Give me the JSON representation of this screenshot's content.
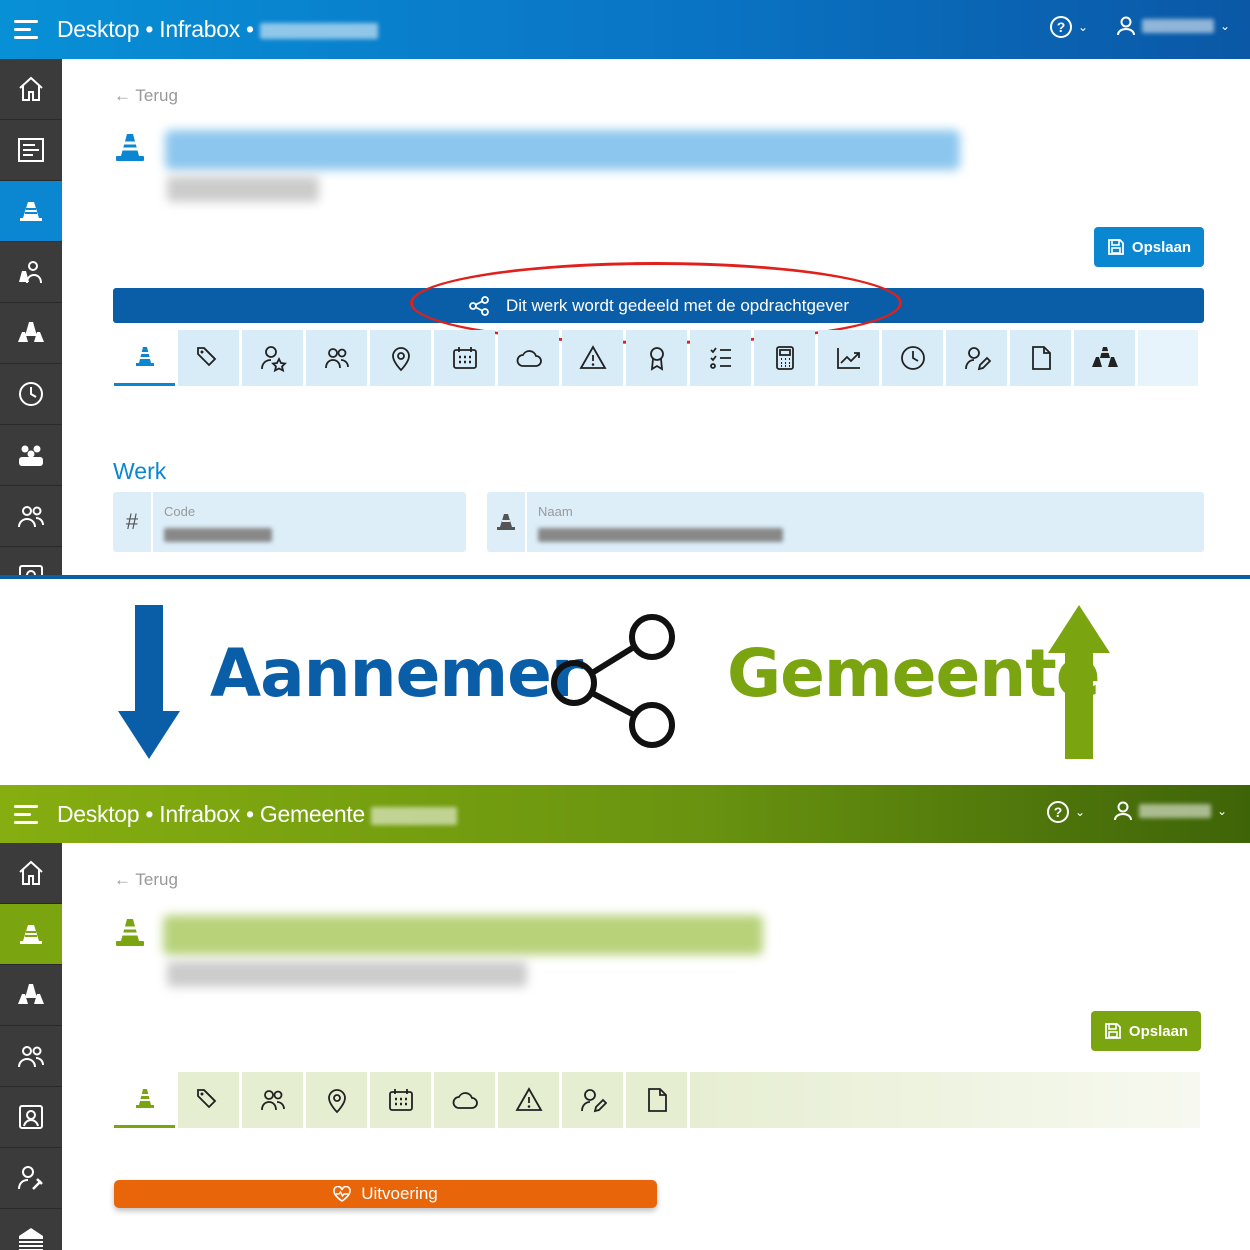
{
  "top": {
    "header": {
      "app": "Desktop",
      "sep": "•",
      "module": "Infrabox",
      "help_icon": "help-circle-icon",
      "user_icon": "user-icon"
    },
    "back_label": "Terug",
    "save_label": "Opslaan",
    "share_banner": "Dit werk wordt gedeeld met de opdrachtgever",
    "section_title": "Werk",
    "fields": [
      {
        "label": "Code",
        "icon": "hash-icon",
        "icon_glyph": "#"
      },
      {
        "label": "Naam",
        "icon": "cone-icon"
      }
    ],
    "tabs": [
      "cone",
      "tags",
      "user-star",
      "users",
      "location-pin",
      "calendar",
      "cloud",
      "warning",
      "award",
      "checklist",
      "calculator",
      "chart-line",
      "clock",
      "user-edit",
      "document",
      "cones"
    ],
    "sidebar": [
      "home",
      "list",
      "cone",
      "person-cone",
      "cones",
      "clock",
      "team",
      "users",
      "contact"
    ],
    "accent": "#0a87d0"
  },
  "middle": {
    "left_label": "Aannemer",
    "right_label": "Gemeente",
    "left_color": "#0a5ea8",
    "right_color": "#7aa410",
    "share_icon": "share-icon"
  },
  "bottom": {
    "header": {
      "app": "Desktop",
      "sep": "•",
      "module": "Infrabox",
      "org": "Gemeente"
    },
    "back_label": "Terug",
    "save_label": "Opslaan",
    "status_label": "Uitvoering",
    "tabs": [
      "cone",
      "tags",
      "users",
      "location-pin",
      "calendar",
      "cloud",
      "warning",
      "user-edit",
      "document"
    ],
    "sidebar": [
      "home",
      "cone",
      "cones",
      "users",
      "contact",
      "user-wrench",
      "building"
    ],
    "accent": "#7aa410"
  }
}
